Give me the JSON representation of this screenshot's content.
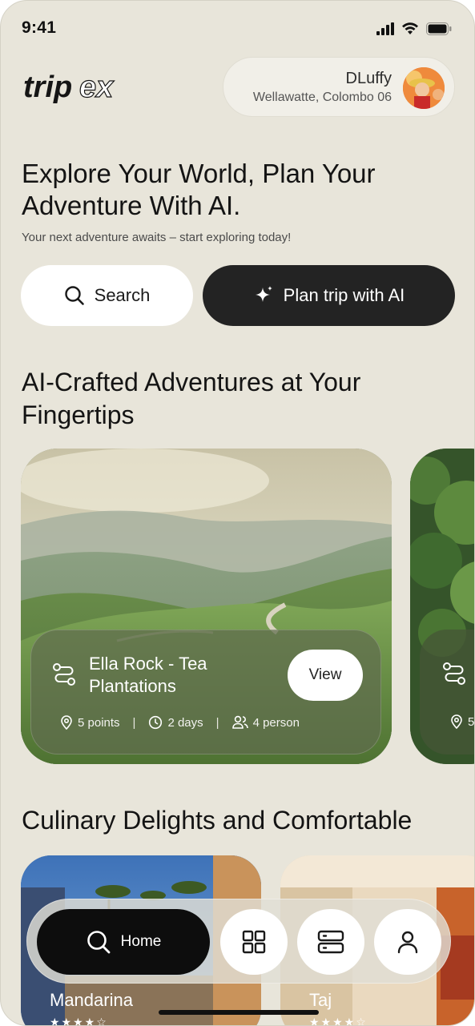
{
  "status_bar": {
    "time": "9:41"
  },
  "header": {
    "logo_text": "tripex",
    "user_name": "DLuffy",
    "user_location": "Wellawatte, Colombo 06"
  },
  "hero": {
    "title_line1": "Explore Your World, Plan Your",
    "title_line2": "Adventure With AI.",
    "subtitle": "Your next adventure awaits – start exploring today!",
    "search_label": "Search",
    "plan_label": "Plan trip with AI"
  },
  "sections": {
    "ai_title_line1": "AI-Crafted Adventures at Your",
    "ai_title_line2": "Fingertips",
    "culinary_title": "Culinary Delights and Comfortable"
  },
  "trip_cards": [
    {
      "title_line1": "Ella Rock - Tea",
      "title_line2": "Plantations",
      "view_label": "View",
      "points": "5 points",
      "days": "2 days",
      "persons": "4 person"
    },
    {
      "points": "5"
    }
  ],
  "hotels": [
    {
      "name": "Mandarina",
      "rating": 4,
      "stars": "★★★★☆"
    },
    {
      "name": "Taj",
      "rating": 4,
      "stars": "★★★★☆"
    }
  ],
  "nav": {
    "home_label": "Home",
    "items": [
      "home-icon",
      "grid-icon",
      "server-icon",
      "profile-icon"
    ]
  },
  "colors": {
    "background": "#e8e5da",
    "dark": "#232323",
    "nav_active": "#0d0d0d"
  }
}
